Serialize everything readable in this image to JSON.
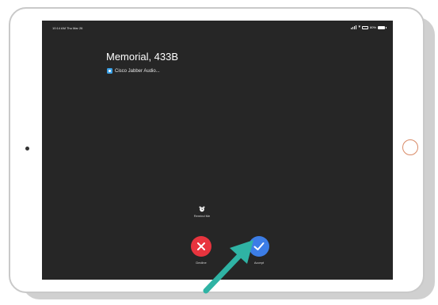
{
  "status_bar": {
    "time": "10:14 AM  Thu Mar 26",
    "battery": "80%"
  },
  "call": {
    "caller": "Memorial, 433B",
    "app_name": "Cisco Jabber Audio..."
  },
  "actions": {
    "remind_me": "Remind Me",
    "decline": "Decline",
    "accept": "Accept"
  },
  "colors": {
    "screen_bg": "#262626",
    "decline": "#e8343e",
    "accept": "#3c7de6",
    "annotation_arrow": "#2fb3a4"
  }
}
